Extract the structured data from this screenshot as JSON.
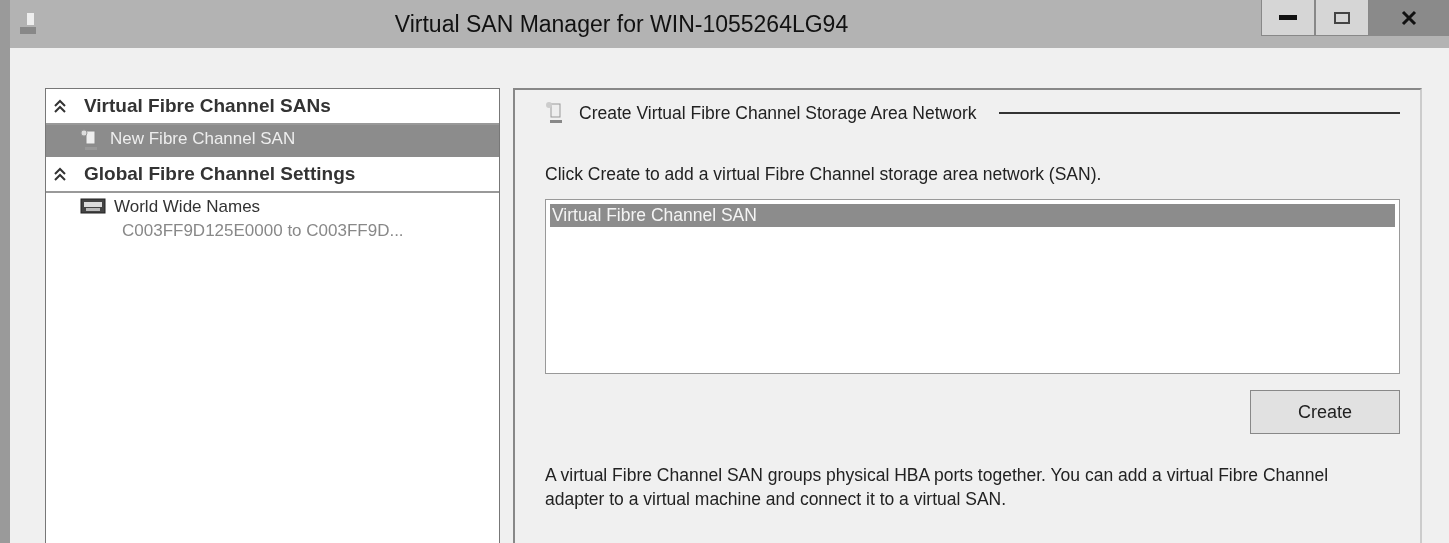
{
  "window": {
    "title": "Virtual SAN Manager for WIN-1055264LG94"
  },
  "sidebar": {
    "sections": [
      {
        "title": "Virtual Fibre Channel SANs",
        "expanded": true,
        "items": [
          {
            "kind": "san",
            "label": "New Fibre Channel SAN",
            "selected": true
          }
        ]
      },
      {
        "title": "Global Fibre Channel Settings",
        "expanded": true,
        "items": [
          {
            "kind": "wwn",
            "label": "World Wide Names",
            "detail": "C003FF9D125E0000 to C003FF9D...",
            "selected": false
          }
        ]
      }
    ]
  },
  "detail": {
    "heading": "Create Virtual Fibre Channel Storage Area Network",
    "instruction": "Click Create to add a virtual Fibre Channel storage area network (SAN).",
    "list": [
      {
        "label": "Virtual Fibre Channel SAN",
        "selected": true
      }
    ],
    "create_button": "Create",
    "description": "A virtual Fibre Channel SAN groups physical HBA ports together. You can add a virtual Fibre Channel adapter to a virtual machine and connect it to a virtual SAN."
  }
}
